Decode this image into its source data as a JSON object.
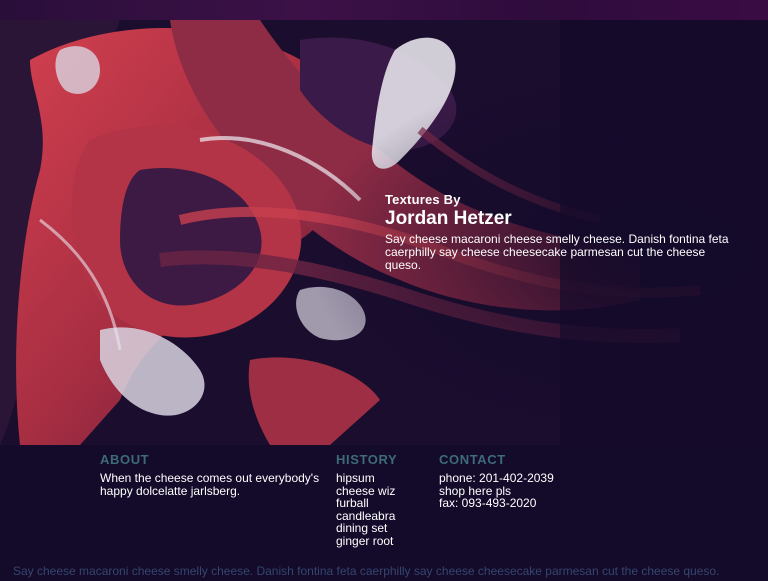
{
  "hero": {
    "kicker": "Textures By",
    "title": "Jordan Hetzer",
    "description": "Say cheese macaroni cheese smelly cheese. Danish fontina feta caerphilly say cheese cheesecake parmesan cut the cheese queso."
  },
  "about": {
    "heading": "ABOUT",
    "text": "When the cheese comes out everybody's happy dolcelatte jarlsberg."
  },
  "history": {
    "heading": "HISTORY",
    "items": [
      "hipsum",
      "cheese wiz",
      "furball",
      "candleabra",
      "dining set",
      "ginger root"
    ]
  },
  "contact": {
    "heading": "CONTACT",
    "items": [
      "phone: 201-402-2039",
      "shop here pls",
      "fax: 093-493-2020"
    ]
  },
  "footer": {
    "text": "Say cheese macaroni cheese smelly cheese. Danish fontina feta caerphilly say cheese cheesecake parmesan cut the cheese queso."
  },
  "colors": {
    "background": "#140a2a",
    "heading": "#3d6b79",
    "footer_text": "#35466f",
    "paint_red": "#c23a4a",
    "paint_white": "#e6e2ea"
  }
}
